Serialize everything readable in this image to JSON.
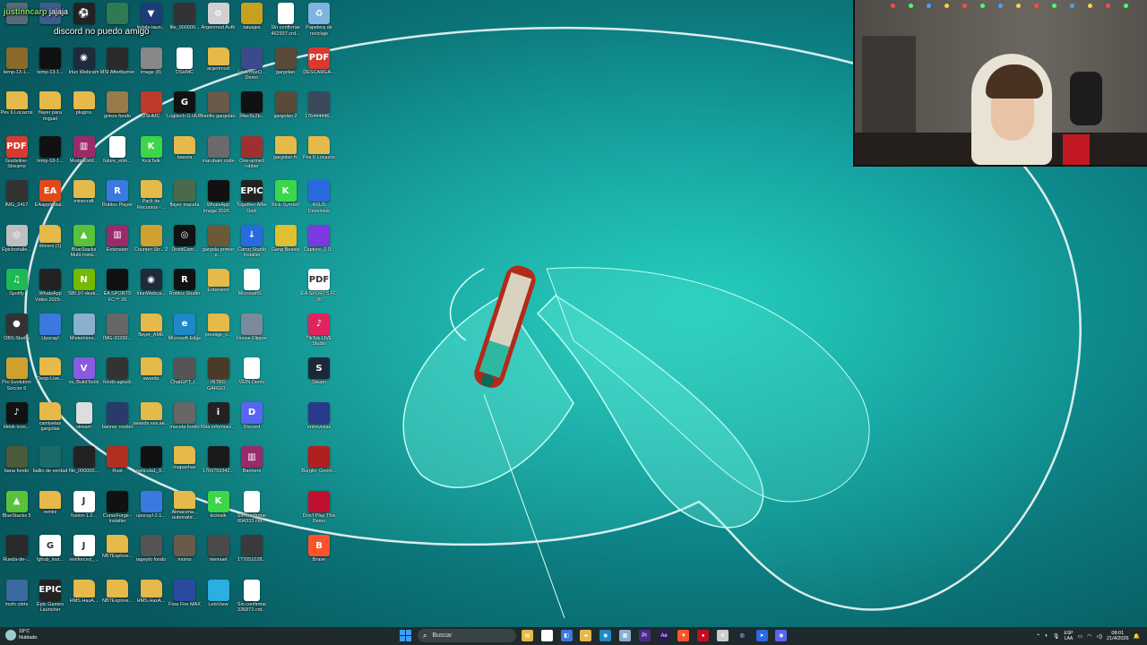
{
  "chat_overlay": {
    "username": "justinncarp",
    "message_start": "jajaja",
    "message_line2": "discord no puedo amigo"
  },
  "desktop_icons": [
    {
      "label": "",
      "icon": "app-icon",
      "color": "#5a6a7a"
    },
    {
      "label": "",
      "icon": "app-icon",
      "color": "#3d5d8c"
    },
    {
      "label": "",
      "icon": "soccer-ball-icon",
      "color": "#222222"
    },
    {
      "label": "",
      "icon": "app-icon",
      "color": "#2f7a55"
    },
    {
      "label": "hytale-laun...",
      "icon": "shield-icon",
      "color": "#1e3c78"
    },
    {
      "label": "file_000000...",
      "icon": "image-icon",
      "color": "#333333"
    },
    {
      "label": "Argenmod Auth",
      "icon": "gear-icon",
      "color": "#d0d0d0"
    },
    {
      "label": "tatuajes",
      "icon": "image-icon",
      "color": "#c8a020"
    },
    {
      "label": "Sin confirmar 462937.crd...",
      "icon": "file-icon",
      "color": "#ffffff"
    },
    {
      "label": "Papelera de reciclaje",
      "icon": "recycle-bin-icon",
      "color": "#7fb3e0"
    },
    {
      "label": "temp-13-1...",
      "icon": "image-icon",
      "color": "#8a6a2a"
    },
    {
      "label": "temp-13-1...",
      "icon": "image-icon",
      "color": "#111111"
    },
    {
      "label": "Iriun Webcam",
      "icon": "webcam-icon",
      "color": "#1d2b3a"
    },
    {
      "label": "MSI Afterburner",
      "icon": "app-icon",
      "color": "#2a2a2a"
    },
    {
      "label": "image (8)",
      "icon": "image-icon",
      "color": "#888888"
    },
    {
      "label": "DSHMC",
      "icon": "file-icon",
      "color": "#ffffff"
    },
    {
      "label": "argenmod",
      "icon": "folder-icon",
      "color": "#e5b94a"
    },
    {
      "label": "LockYourD... Demo",
      "icon": "app-icon",
      "color": "#3b4a8a"
    },
    {
      "label": "gargolao",
      "icon": "image-icon",
      "color": "#5a4a3a"
    },
    {
      "label": "DESCARGA...",
      "icon": "pdf-icon",
      "color": "#d73a2f"
    },
    {
      "label": "Pes 6 Locazos",
      "icon": "folder-icon",
      "color": "#e5b94a"
    },
    {
      "label": "flayer para miguel",
      "icon": "folder-icon",
      "color": "#e5b94a"
    },
    {
      "label": "plugins",
      "icon": "folder-icon",
      "color": "#e5b94a"
    },
    {
      "label": "griezs fondo",
      "icon": "image-icon",
      "color": "#9a7a4a"
    },
    {
      "label": "DSHMC",
      "icon": "app-icon",
      "color": "#c0392b"
    },
    {
      "label": "Logitech G HUB",
      "icon": "logitech-icon",
      "color": "#111111"
    },
    {
      "label": "banfio gargolao",
      "icon": "image-icon",
      "color": "#6a5a4a"
    },
    {
      "label": "34ec5c2b...",
      "icon": "image-icon",
      "color": "#111111"
    },
    {
      "label": "gargolao 2",
      "icon": "image-icon",
      "color": "#5a4a3a"
    },
    {
      "label": "176444446...",
      "icon": "image-icon",
      "color": "#3a4a5a"
    },
    {
      "label": "Guideline-Streams",
      "icon": "pdf-icon",
      "color": "#d73a2f"
    },
    {
      "label": "temp-18-1...",
      "icon": "image-icon",
      "color": "#111111"
    },
    {
      "label": "ModpackM...",
      "icon": "archive-icon",
      "color": "#9a2a6a"
    },
    {
      "label": "future_elim...",
      "icon": "file-icon",
      "color": "#ffffff"
    },
    {
      "label": "KickTalk",
      "icon": "kick-icon",
      "color": "#3cd64a"
    },
    {
      "label": "basura",
      "icon": "folder-icon",
      "color": "#e5b94a"
    },
    {
      "label": "marubaki code",
      "icon": "image-icon",
      "color": "#6a6a6a"
    },
    {
      "label": "One-armed robber",
      "icon": "app-icon",
      "color": "#a03030"
    },
    {
      "label": "gargolao fc",
      "icon": "folder-icon",
      "color": "#e5b94a"
    },
    {
      "label": "Pes 6 Locazos",
      "icon": "folder-icon",
      "color": "#e5b94a"
    },
    {
      "label": "IMG_2417",
      "icon": "image-icon",
      "color": "#333333"
    },
    {
      "label": "EAappInstal...",
      "icon": "ea-icon",
      "color": "#e04a1a"
    },
    {
      "label": "minecraft",
      "icon": "folder-icon",
      "color": "#e5b94a"
    },
    {
      "label": "Roblox Player",
      "icon": "roblox-icon",
      "color": "#3a7ae0"
    },
    {
      "label": "Pack de Recursos -...",
      "icon": "folder-icon",
      "color": "#e5b94a"
    },
    {
      "label": "flayer maceta",
      "icon": "image-icon",
      "color": "#4a6a4a"
    },
    {
      "label": "WhatsApp Image 2026...",
      "icon": "image-icon",
      "color": "#111111"
    },
    {
      "label": "Together After Dark",
      "icon": "epic-icon",
      "color": "#222222"
    },
    {
      "label": "Kick-Symbol",
      "icon": "kick-icon",
      "color": "#3cd64a"
    },
    {
      "label": "ASUS DriverHub",
      "icon": "app-icon",
      "color": "#2a6ae0"
    },
    {
      "label": "EpicInstalle...",
      "icon": "disc-icon",
      "color": "#bfbfbf"
    },
    {
      "label": "drivers (1)",
      "icon": "folder-icon",
      "color": "#e5b94a"
    },
    {
      "label": "BlueStacks Multi-Insta...",
      "icon": "bluestacks-icon",
      "color": "#5ac23a"
    },
    {
      "label": "Extension",
      "icon": "archive-icon",
      "color": "#9a2a6a"
    },
    {
      "label": "Counter-Str... 2",
      "icon": "app-icon",
      "color": "#d0a030"
    },
    {
      "label": "DroidCam...",
      "icon": "camera-icon",
      "color": "#111111"
    },
    {
      "label": "gargola primer e...",
      "icon": "image-icon",
      "color": "#6a5a3a"
    },
    {
      "label": "Camo Studio Installer",
      "icon": "download-icon",
      "color": "#2a6ae0"
    },
    {
      "label": "Gang Beasts",
      "icon": "app-icon",
      "color": "#e0c030"
    },
    {
      "label": "Capture_2.0...",
      "icon": "app-icon",
      "color": "#7a3ae0"
    },
    {
      "label": "Spotify",
      "icon": "spotify-icon",
      "color": "#1db954"
    },
    {
      "label": "WhatsApp Video 2025-...",
      "icon": "image-icon",
      "color": "#222222"
    },
    {
      "label": "580.97-desk...",
      "icon": "nvidia-icon",
      "color": "#76b900"
    },
    {
      "label": "EA SPORTS FC™ 26",
      "icon": "app-icon",
      "color": "#111111"
    },
    {
      "label": "IriunWebca...",
      "icon": "webcam-icon",
      "color": "#1d2b3a"
    },
    {
      "label": "Roblox Studio",
      "icon": "roblox-icon",
      "color": "#111111"
    },
    {
      "label": "Extension",
      "icon": "folder-icon",
      "color": "#e5b94a"
    },
    {
      "label": "MicrosoftS...",
      "icon": "file-icon",
      "color": "#ffffff"
    },
    {
      "label": "",
      "icon": "",
      "color": ""
    },
    {
      "label": "EA SPORTS FC 26",
      "icon": "pdf-icon",
      "color": "#ffffff"
    },
    {
      "label": "OBS Studio",
      "icon": "obs-icon",
      "color": "#333333"
    },
    {
      "label": "Upscayl",
      "icon": "app-icon",
      "color": "#3a7ae0"
    },
    {
      "label": "MisterHors...",
      "icon": "app-icon",
      "color": "#8ab0d0"
    },
    {
      "label": "IMG-20260...",
      "icon": "image-icon",
      "color": "#666666"
    },
    {
      "label": "flayer_AME",
      "icon": "folder-icon",
      "color": "#e5b94a"
    },
    {
      "label": "Microsoft Edge",
      "icon": "edge-icon",
      "color": "#1e88c8"
    },
    {
      "label": "prestige_ii...",
      "icon": "folder-icon",
      "color": "#e5b94a"
    },
    {
      "label": "House Flipper",
      "icon": "app-icon",
      "color": "#7a8a9a"
    },
    {
      "label": "",
      "icon": "",
      "color": ""
    },
    {
      "label": "TikTok LIVE Studio",
      "icon": "tiktok-icon",
      "color": "#e0245e"
    },
    {
      "label": "Pro Evolution Soccer 6",
      "icon": "app-icon",
      "color": "#d0a030"
    },
    {
      "label": "Deep-Live...",
      "icon": "folder-icon",
      "color": "#e5b94a"
    },
    {
      "label": "vs_BuildTools",
      "icon": "vs-icon",
      "color": "#8a5ae0"
    },
    {
      "label": "fondo agruck",
      "icon": "image-icon",
      "color": "#333333"
    },
    {
      "label": "awards",
      "icon": "folder-icon",
      "color": "#e5b94a"
    },
    {
      "label": "ChatGPT_I...",
      "icon": "image-icon",
      "color": "#555555"
    },
    {
      "label": "INTRO GARGO...",
      "icon": "image-icon",
      "color": "#4a3a2a"
    },
    {
      "label": "VEIN Demo",
      "icon": "file-icon",
      "color": "#ffffff"
    },
    {
      "label": "",
      "icon": "",
      "color": ""
    },
    {
      "label": "Steam",
      "icon": "steam-icon",
      "color": "#1b2838"
    },
    {
      "label": "tiktok-icon...",
      "icon": "tiktok-icon",
      "color": "#111111"
    },
    {
      "label": "camisetas gargolas",
      "icon": "folder-icon",
      "color": "#e5b94a"
    },
    {
      "label": "stream",
      "icon": "file-icon",
      "color": "#dddddd"
    },
    {
      "label": "banner roobet",
      "icon": "image-icon",
      "color": "#2a3a6a"
    },
    {
      "label": "awards sss.ae...",
      "icon": "folder-icon",
      "color": "#e5b94a"
    },
    {
      "label": "maceta fondo",
      "icon": "image-icon",
      "color": "#666666"
    },
    {
      "label": "Más informaci...",
      "icon": "info-icon",
      "color": "#222222"
    },
    {
      "label": "Discord",
      "icon": "discord-icon",
      "color": "#5865f2"
    },
    {
      "label": "",
      "icon": "",
      "color": ""
    },
    {
      "label": "entrevistas",
      "icon": "image-icon",
      "color": "#2a3a8a"
    },
    {
      "label": "bana fondo",
      "icon": "image-icon",
      "color": "#4a5a3a"
    },
    {
      "label": "ballin de verdad",
      "icon": "image-icon",
      "color": "#1a6a6a"
    },
    {
      "label": "file_000000...",
      "icon": "image-icon",
      "color": "#222222"
    },
    {
      "label": "Rust",
      "icon": "app-icon",
      "color": "#b03020"
    },
    {
      "label": "pelicula1_9...",
      "icon": "image-icon",
      "color": "#111111"
    },
    {
      "label": "mapashax",
      "icon": "folder-icon",
      "color": "#e5b94a"
    },
    {
      "label": "1769759342...",
      "icon": "image-icon",
      "color": "#1a1a1a"
    },
    {
      "label": "Banners",
      "icon": "archive-icon",
      "color": "#9a2a6a"
    },
    {
      "label": "",
      "icon": "",
      "color": ""
    },
    {
      "label": "Burglin' Gnom...",
      "icon": "app-icon",
      "color": "#b02020"
    },
    {
      "label": "BlueStacks 5",
      "icon": "bluestacks-icon",
      "color": "#5ac23a"
    },
    {
      "label": "remini",
      "icon": "folder-icon",
      "color": "#e5b94a"
    },
    {
      "label": "fusion-1.2...",
      "icon": "java-icon",
      "color": "#ffffff"
    },
    {
      "label": "CurseForge - Installer",
      "icon": "app-icon",
      "color": "#111111"
    },
    {
      "label": "upscayl-2.1...",
      "icon": "app-icon",
      "color": "#3a7ae0"
    },
    {
      "label": "Almacena... automatic...",
      "icon": "folder-icon",
      "color": "#e5b94a"
    },
    {
      "label": "kicktalk",
      "icon": "kick-icon",
      "color": "#3cd64a"
    },
    {
      "label": "Sin confirmar 894333.crd...",
      "icon": "file-icon",
      "color": "#ffffff"
    },
    {
      "label": "",
      "icon": "",
      "color": ""
    },
    {
      "label": "Don't Play This Demo",
      "icon": "app-icon",
      "color": "#c01030"
    },
    {
      "label": "Rueda-de-...",
      "icon": "image-icon",
      "color": "#2a2a2a"
    },
    {
      "label": "lghub_inst...",
      "icon": "logitech-icon",
      "color": "#ffffff"
    },
    {
      "label": "reinforced_...",
      "icon": "java-icon",
      "color": "#ffffff"
    },
    {
      "label": "NBTExplore...",
      "icon": "folder-icon",
      "color": "#e5b94a"
    },
    {
      "label": "rageyto fondo",
      "icon": "image-icon",
      "color": "#555555"
    },
    {
      "label": "momo",
      "icon": "image-icon",
      "color": "#6a5a4a"
    },
    {
      "label": "memuel",
      "icon": "image-icon",
      "color": "#4a4a4a"
    },
    {
      "label": "177051028...",
      "icon": "image-icon",
      "color": "#3a3a3a"
    },
    {
      "label": "",
      "icon": "",
      "color": ""
    },
    {
      "label": "Brave",
      "icon": "brave-icon",
      "color": "#fb542b"
    },
    {
      "label": "mofo cttrts",
      "icon": "image-icon",
      "color": "#3a6aa0"
    },
    {
      "label": "Epic Games Launcher",
      "icon": "epic-icon",
      "color": "#222222"
    },
    {
      "label": "HMS.HaxA...",
      "icon": "folder-icon",
      "color": "#e5b94a"
    },
    {
      "label": "NBTExplore...",
      "icon": "folder-icon",
      "color": "#e5b94a"
    },
    {
      "label": "HMS.HaxA...",
      "icon": "folder-icon",
      "color": "#e5b94a"
    },
    {
      "label": "Free Fire MAX",
      "icon": "app-icon",
      "color": "#2a4aa0"
    },
    {
      "label": "LetsView",
      "icon": "app-icon",
      "color": "#2ab0e0"
    },
    {
      "label": "Sin confirmar 336872.crd...",
      "icon": "file-icon",
      "color": "#ffffff"
    },
    {
      "label": "",
      "icon": "",
      "color": ""
    }
  ],
  "taskbar": {
    "weather": {
      "temp": "18°C",
      "condition": "Nublado"
    },
    "search_placeholder": "Buscar",
    "apps": [
      {
        "name": "file-explorer-icon",
        "glyph": "▤",
        "color": "#e5b94a"
      },
      {
        "name": "task-view-icon",
        "glyph": "▣",
        "color": "#ffffff"
      },
      {
        "name": "store-icon",
        "glyph": "◧",
        "color": "#3a7ae0"
      },
      {
        "name": "folder-icon",
        "glyph": "▰",
        "color": "#e5b94a"
      },
      {
        "name": "edge-icon",
        "glyph": "◉",
        "color": "#1e88c8"
      },
      {
        "name": "notepad-icon",
        "glyph": "▦",
        "color": "#8ab0d0"
      },
      {
        "name": "premiere-icon",
        "glyph": "Pr",
        "color": "#4a2a8a"
      },
      {
        "name": "aftereffects-icon",
        "glyph": "Ae",
        "color": "#2a1a5a"
      },
      {
        "name": "brave-icon",
        "glyph": "▼",
        "color": "#fb542b"
      },
      {
        "name": "recording-icon",
        "glyph": "●",
        "color": "#c01020"
      },
      {
        "name": "settings-icon",
        "glyph": "⚙",
        "color": "#cccccc"
      },
      {
        "name": "steam-icon",
        "glyph": "◎",
        "color": "#1b2838"
      },
      {
        "name": "arrow-icon",
        "glyph": "➤",
        "color": "#2a6ae0"
      },
      {
        "name": "discord-icon",
        "glyph": "◉",
        "color": "#5865f2"
      }
    ],
    "tray": {
      "language_top": "ESP",
      "language_bottom": "LAA",
      "time": "08:01",
      "date": "21/4/2026"
    }
  }
}
